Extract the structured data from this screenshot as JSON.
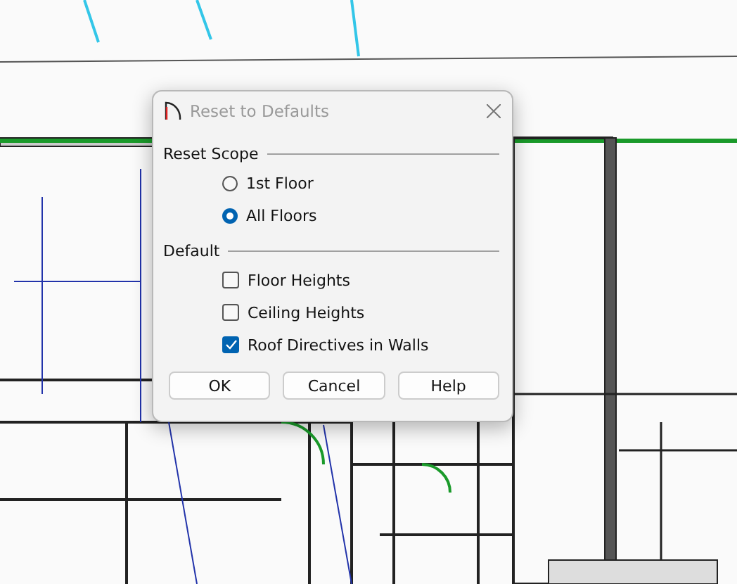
{
  "dialog": {
    "title": "Reset to Defaults",
    "active": false
  },
  "groups": [
    {
      "title": "Reset Scope",
      "options": [
        {
          "kind": "radio",
          "label": "1st Floor",
          "selected": false
        },
        {
          "kind": "radio",
          "label": "All Floors",
          "selected": true
        }
      ]
    },
    {
      "title": "Default",
      "options": [
        {
          "kind": "checkbox",
          "label": "Floor Heights",
          "checked": false
        },
        {
          "kind": "checkbox",
          "label": "Ceiling Heights",
          "checked": false
        },
        {
          "kind": "checkbox",
          "label": "Roof Directives in Walls",
          "checked": true
        }
      ]
    }
  ],
  "buttons": [
    "OK",
    "Cancel",
    "Help"
  ]
}
